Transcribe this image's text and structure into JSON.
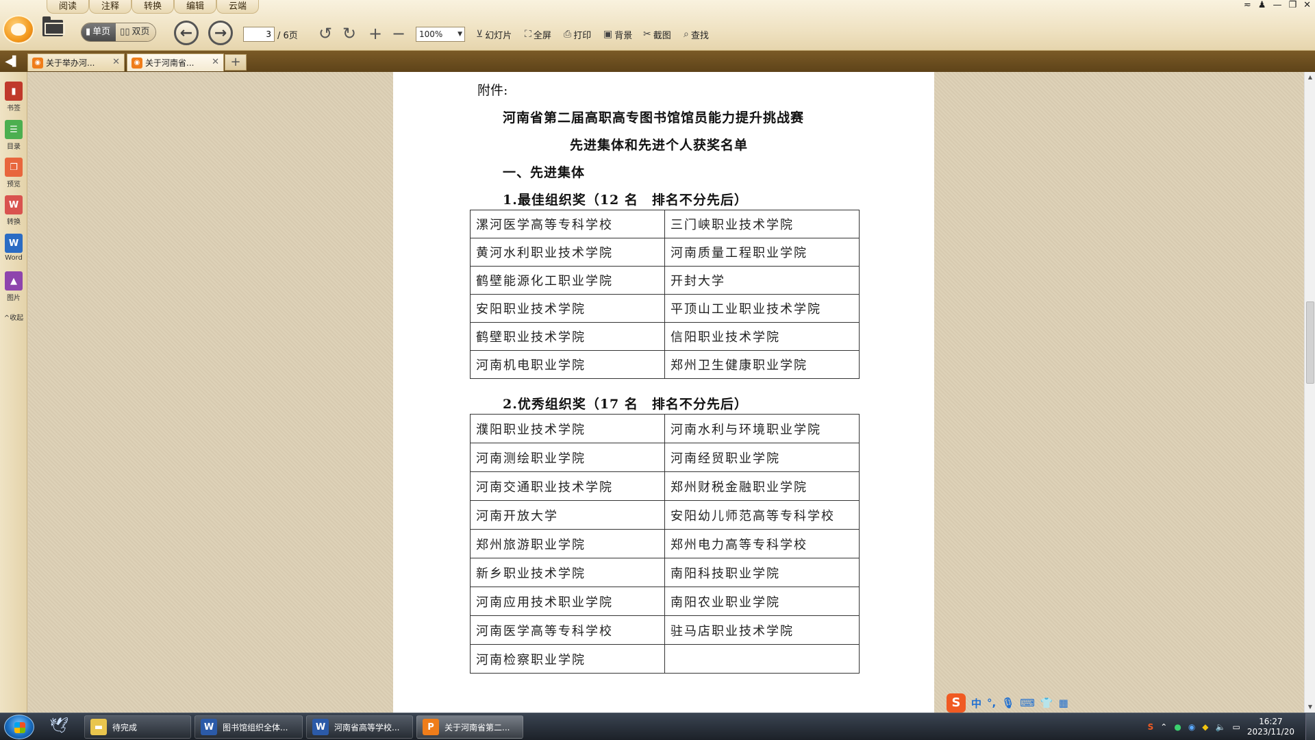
{
  "menu": {
    "tabs": [
      "阅读",
      "注释",
      "转换",
      "编辑",
      "云端"
    ]
  },
  "toolbar": {
    "view_single": "单页",
    "view_double": "双页",
    "page_current": "3",
    "page_total": "/ 6页",
    "zoom": "100%",
    "slideshow": "幻灯片",
    "fullscreen": "全屏",
    "print": "打印",
    "background": "背景",
    "screenshot": "截图",
    "find": "查找"
  },
  "tabs": [
    {
      "label": "关于举办河..."
    },
    {
      "label": "关于河南省..."
    }
  ],
  "sidebar": {
    "items": [
      {
        "label": "书签",
        "icon": "bookmark-icon",
        "color": "#c0392b"
      },
      {
        "label": "目录",
        "icon": "toc-icon",
        "color": "#4caf50"
      },
      {
        "label": "预览",
        "icon": "preview-icon",
        "color": "#e8663d"
      },
      {
        "label": "转换",
        "icon": "convert-icon",
        "color": "#d9534f"
      },
      {
        "label": "Word",
        "icon": "word-icon",
        "color": "#2b6cc4"
      },
      {
        "label": "图片",
        "icon": "image-icon",
        "color": "#8e44ad"
      }
    ],
    "collapse": "^收起"
  },
  "document": {
    "attachment": "附件:",
    "title1": "河南省第二届高职高专图书馆馆员能力提升挑战赛",
    "title2": "先进集体和先进个人获奖名单",
    "section1": "一、先进集体",
    "award1": "1.最佳组织奖（12 名　排名不分先后）",
    "award1_rows": [
      [
        "漯河医学高等专科学校",
        "三门峡职业技术学院"
      ],
      [
        "黄河水利职业技术学院",
        "河南质量工程职业学院"
      ],
      [
        "鹤壁能源化工职业学院",
        "开封大学"
      ],
      [
        "安阳职业技术学院",
        "平顶山工业职业技术学院"
      ],
      [
        "鹤壁职业技术学院",
        "信阳职业技术学院"
      ],
      [
        "河南机电职业学院",
        "郑州卫生健康职业学院"
      ]
    ],
    "award2": "2.优秀组织奖（17 名　排名不分先后）",
    "award2_rows": [
      [
        "濮阳职业技术学院",
        "河南水利与环境职业学院"
      ],
      [
        "河南测绘职业学院",
        "河南经贸职业学院"
      ],
      [
        "河南交通职业技术学院",
        "郑州财税金融职业学院"
      ],
      [
        "河南开放大学",
        "安阳幼儿师范高等专科学校"
      ],
      [
        "郑州旅游职业学院",
        "郑州电力高等专科学校"
      ],
      [
        "新乡职业技术学院",
        "南阳科技职业学院"
      ],
      [
        "河南应用技术职业学院",
        "南阳农业职业学院"
      ],
      [
        "河南医学高等专科学校",
        "驻马店职业技术学院"
      ],
      [
        "河南检察职业学院",
        ""
      ]
    ]
  },
  "ime": {
    "lang": "中"
  },
  "taskbar": {
    "items": [
      {
        "label": "待完成",
        "icon": "folder-icon"
      },
      {
        "label": "图书馆组织全体...",
        "icon": "word-icon"
      },
      {
        "label": "河南省高等学校...",
        "icon": "word-icon"
      },
      {
        "label": "关于河南省第二...",
        "icon": "pdf-icon"
      }
    ],
    "time": "16:27",
    "date": "2023/11/20"
  }
}
